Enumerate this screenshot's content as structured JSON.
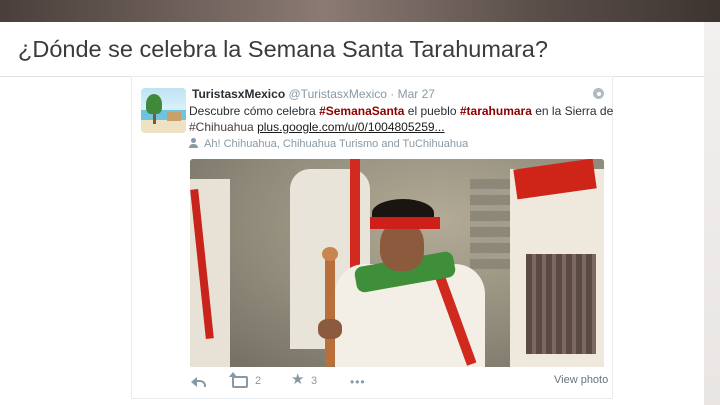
{
  "slide": {
    "title": "¿Dónde se celebra la Semana Santa Tarahumara?"
  },
  "tweet": {
    "display_name": "TuristasxMexico",
    "handle": "@TuristasxMexico",
    "separator": "·",
    "date": "Mar 27",
    "text": {
      "line1_a": "Descubre cómo celebra ",
      "hashtag_semana": "#SemanaSanta",
      "line1_b": " el pueblo ",
      "hashtag_tarahumara": "#tarahumara",
      "line1_c": " en la Sierra de",
      "hashtag_chihuahua": "#Chihuahua",
      "line2_b": " ",
      "link": "plus.google.com/u/0/1004805259..."
    },
    "retweeted_by": "Ah! Chihuahua, Chihuahua Turismo and TuChihuahua",
    "actions": {
      "retweet_count": "2",
      "favorite_count": "3",
      "more": "•••",
      "view_photo": "View photo"
    },
    "icons": {
      "reply": "reply-icon",
      "retweet": "retweet-icon",
      "favorite": "star-icon",
      "more": "more-icon",
      "settings": "gear-icon",
      "retweeted_by": "person-icon"
    },
    "colors": {
      "hashtag": "#8b0000",
      "meta_text": "#8899a6"
    }
  }
}
